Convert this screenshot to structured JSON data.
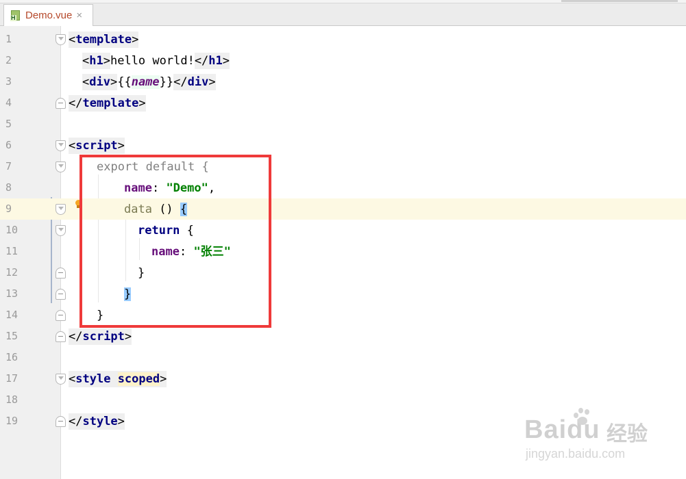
{
  "tab": {
    "label": "Demo.vue",
    "close": "×",
    "file_icon_letter": "H"
  },
  "lines": [
    {
      "num": "1"
    },
    {
      "num": "2"
    },
    {
      "num": "3"
    },
    {
      "num": "4"
    },
    {
      "num": "5"
    },
    {
      "num": "6"
    },
    {
      "num": "7"
    },
    {
      "num": "8"
    },
    {
      "num": "9"
    },
    {
      "num": "10"
    },
    {
      "num": "11"
    },
    {
      "num": "12"
    },
    {
      "num": "13"
    },
    {
      "num": "14"
    },
    {
      "num": "15"
    },
    {
      "num": "16"
    },
    {
      "num": "17"
    },
    {
      "num": "18"
    },
    {
      "num": "19"
    }
  ],
  "code": {
    "l1": {
      "lt": "<",
      "tag": "template",
      "gt": ">"
    },
    "l2": {
      "lt": "<",
      "tag": "h1",
      "gt": ">",
      "text": "hello world!",
      "clt": "</",
      "ctag": "h1",
      "cgt": ">"
    },
    "l3": {
      "lt": "<",
      "tag": "div",
      "gt": ">",
      "open": "{{",
      "expr": "name",
      "close": "}}",
      "clt": "</",
      "ctag": "div",
      "cgt": ">"
    },
    "l4": {
      "clt": "</",
      "tag": "template",
      "gt": ">"
    },
    "l6": {
      "lt": "<",
      "tag": "script",
      "gt": ">"
    },
    "l7": {
      "text": "export default {"
    },
    "l8": {
      "prop": "name",
      "colon": ": ",
      "str": "\"Demo\"",
      "comma": ","
    },
    "l9": {
      "fn": "data",
      "parens": " () ",
      "brace": "{"
    },
    "l10": {
      "kw": "return",
      "brace": " {"
    },
    "l11": {
      "prop": "name",
      "colon": ": ",
      "str": "\"张三\""
    },
    "l12": {
      "brace": "}"
    },
    "l13": {
      "brace": "}"
    },
    "l14": {
      "brace": "}"
    },
    "l15": {
      "clt": "</",
      "tag": "script",
      "gt": ">"
    },
    "l17": {
      "lt": "<",
      "tag": "style",
      "space": " ",
      "attr": "scoped",
      "gt": ">"
    },
    "l19": {
      "clt": "</",
      "tag": "style",
      "gt": ">"
    }
  },
  "colors": {
    "annotation": "#ef3a3a",
    "current_line": "#fdf9e3",
    "tag": "#000080",
    "string": "#008000",
    "property": "#660e7a"
  },
  "icons": [
    "file-vue-icon",
    "close-icon",
    "fold-marker-icon",
    "bulb-icon"
  ],
  "watermark": {
    "brand": "Bai",
    "brand2": "du",
    "cn": "经验",
    "url": "jingyan.baidu.com"
  }
}
